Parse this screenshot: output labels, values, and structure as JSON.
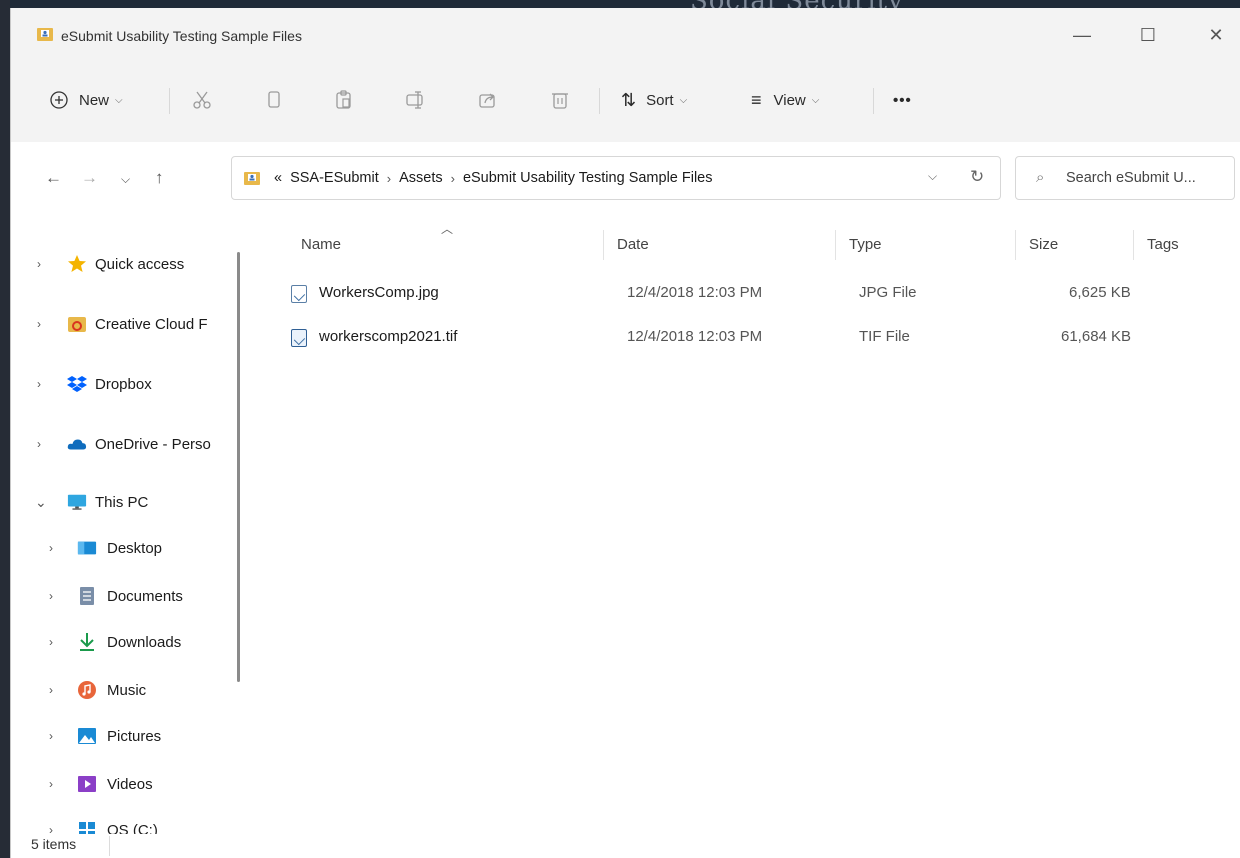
{
  "background": {
    "site_text": "Social Security"
  },
  "window": {
    "title": "eSubmit Usability Testing Sample Files",
    "controls": {
      "minimize": "—",
      "maximize": "☐",
      "close": "✕"
    }
  },
  "toolbar": {
    "new_label": "New",
    "sort_label": "Sort",
    "view_label": "View",
    "more_label": "•••"
  },
  "address": {
    "overflow": "«",
    "breadcrumb": [
      "SSA-ESubmit",
      "Assets",
      "eSubmit Usability Testing Sample Files"
    ],
    "separator": "›"
  },
  "search": {
    "placeholder": "Search eSubmit U..."
  },
  "sidebar": {
    "items": [
      {
        "label": "Quick access",
        "icon": "star-icon",
        "expanded": false
      },
      {
        "label": "Creative Cloud F",
        "icon": "creative-cloud-icon",
        "expanded": false
      },
      {
        "label": "Dropbox",
        "icon": "dropbox-icon",
        "expanded": false
      },
      {
        "label": "OneDrive - Perso",
        "icon": "onedrive-icon",
        "expanded": false
      },
      {
        "label": "This PC",
        "icon": "monitor-icon",
        "expanded": true
      },
      {
        "label": "Desktop",
        "icon": "desktop-icon",
        "expanded": false
      },
      {
        "label": "Documents",
        "icon": "documents-icon",
        "expanded": false
      },
      {
        "label": "Downloads",
        "icon": "download-icon",
        "expanded": false
      },
      {
        "label": "Music",
        "icon": "music-icon",
        "expanded": false
      },
      {
        "label": "Pictures",
        "icon": "pictures-icon",
        "expanded": false
      },
      {
        "label": "Videos",
        "icon": "videos-icon",
        "expanded": false
      },
      {
        "label": "OS (C:)",
        "icon": "drive-icon",
        "expanded": false
      }
    ]
  },
  "columns": {
    "name": "Name",
    "date": "Date",
    "type": "Type",
    "size": "Size",
    "tags": "Tags"
  },
  "files": [
    {
      "name": "WorkersComp.jpg",
      "date": "12/4/2018 12:03 PM",
      "type": "JPG File",
      "size": "6,625 KB"
    },
    {
      "name": "workerscomp2021.tif",
      "date": "12/4/2018 12:03 PM",
      "type": "TIF File",
      "size": "61,684 KB"
    }
  ],
  "status": {
    "items_count": "5 items"
  },
  "colors": {
    "accent": "#0067c0",
    "folder": "#e8b84a",
    "star": "#f4b400"
  }
}
